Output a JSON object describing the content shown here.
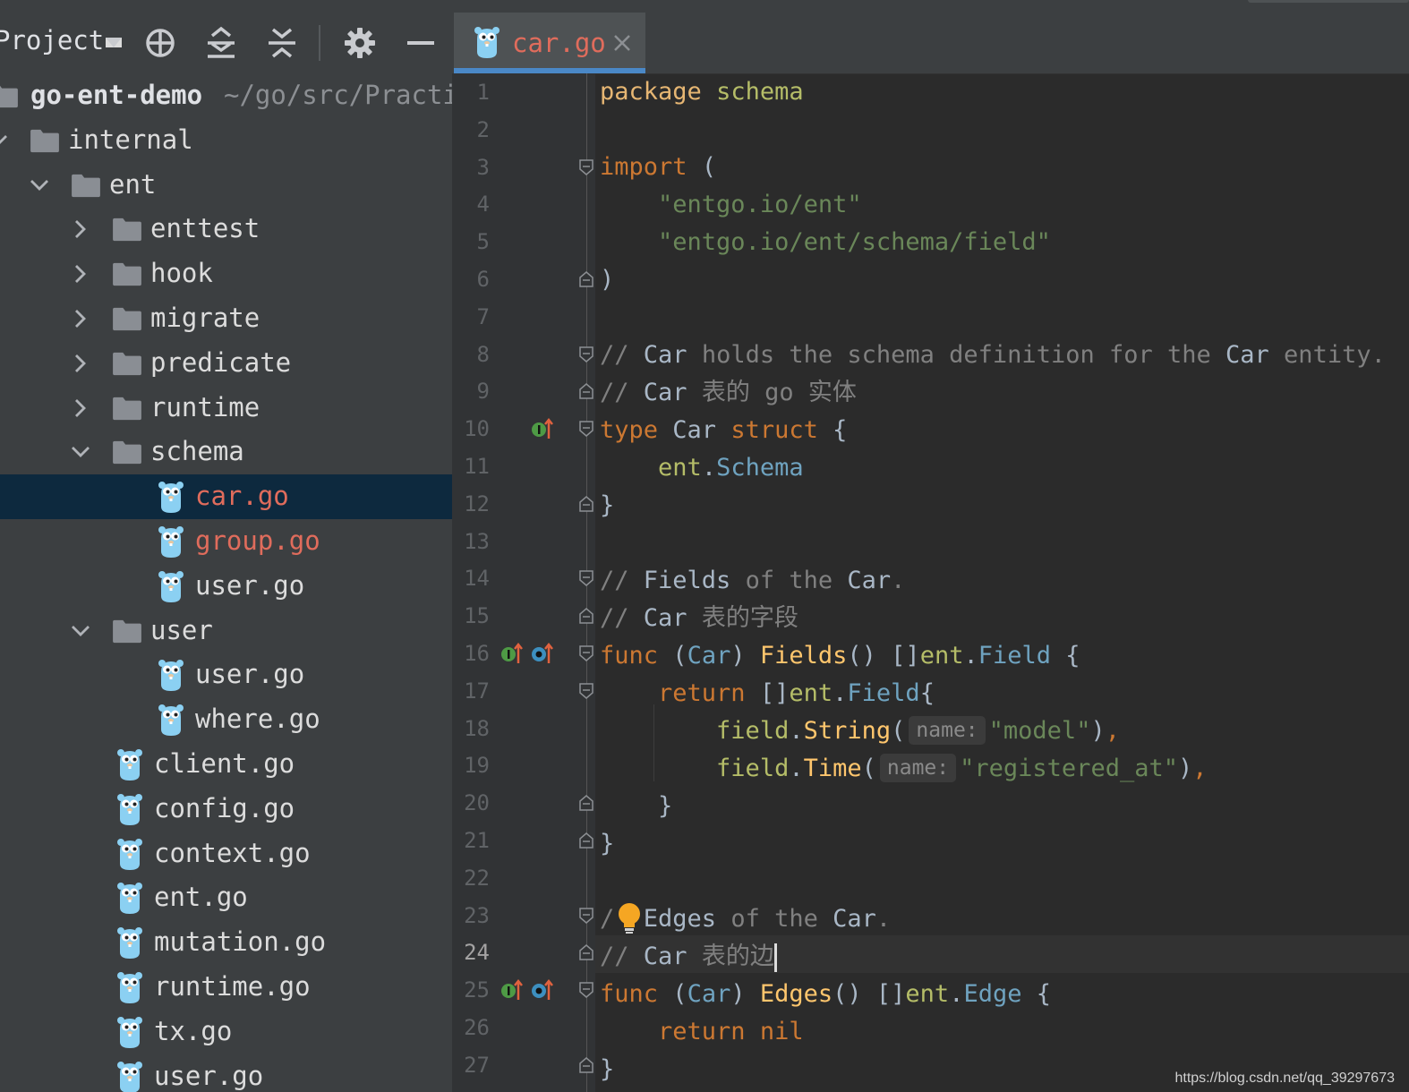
{
  "sidebar": {
    "project_label": "Project",
    "tree": [
      {
        "label": "go-ent-demo",
        "path": "~/go/src/Practi",
        "kind": "root"
      },
      {
        "label": "internal",
        "kind": "folder",
        "chevron": "down"
      },
      {
        "label": "ent",
        "kind": "folder",
        "chevron": "down"
      },
      {
        "label": "enttest",
        "kind": "folder",
        "chevron": "right"
      },
      {
        "label": "hook",
        "kind": "folder",
        "chevron": "right"
      },
      {
        "label": "migrate",
        "kind": "folder",
        "chevron": "right"
      },
      {
        "label": "predicate",
        "kind": "folder",
        "chevron": "right"
      },
      {
        "label": "runtime",
        "kind": "folder",
        "chevron": "right"
      },
      {
        "label": "schema",
        "kind": "folder",
        "chevron": "down"
      },
      {
        "label": "car.go",
        "kind": "file",
        "status": "modified",
        "selected": true
      },
      {
        "label": "group.go",
        "kind": "file",
        "status": "modified"
      },
      {
        "label": "user.go",
        "kind": "file"
      },
      {
        "label": "user",
        "kind": "folder",
        "chevron": "down"
      },
      {
        "label": "user.go",
        "kind": "file"
      },
      {
        "label": "where.go",
        "kind": "file"
      },
      {
        "label": "client.go",
        "kind": "file"
      },
      {
        "label": "config.go",
        "kind": "file"
      },
      {
        "label": "context.go",
        "kind": "file"
      },
      {
        "label": "ent.go",
        "kind": "file"
      },
      {
        "label": "mutation.go",
        "kind": "file"
      },
      {
        "label": "runtime.go",
        "kind": "file"
      },
      {
        "label": "tx.go",
        "kind": "file"
      },
      {
        "label": "user.go",
        "kind": "file"
      }
    ]
  },
  "editor": {
    "tab": {
      "label": "car.go",
      "icon": "gopher-icon",
      "close_icon": "close-icon"
    },
    "current_line": 24,
    "line_numbers": [
      "1",
      "2",
      "3",
      "4",
      "5",
      "6",
      "7",
      "8",
      "9",
      "10",
      "11",
      "12",
      "13",
      "14",
      "15",
      "16",
      "17",
      "18",
      "19",
      "20",
      "21",
      "22",
      "23",
      "24",
      "25",
      "26",
      "27"
    ],
    "code": {
      "l1_kw": "package",
      "l1_name": "schema",
      "l3_kw": "import",
      "l3_paren": "(",
      "l4_str": "\"entgo.io/ent\"",
      "l5_str": "\"entgo.io/ent/schema/field\"",
      "l6": ")",
      "l8_a": "// ",
      "l8_b": "Car",
      "l8_c": " holds the schema definition for the ",
      "l8_d": "Car",
      "l8_e": " entity.",
      "l9_a": "// ",
      "l9_b": "Car",
      "l9_c": " 表的 go 实体",
      "l10_kw": "type",
      "l10_name": "Car",
      "l10_kw2": "struct",
      "l10_brace": "{",
      "l11_pkg": "ent",
      "l11_dot": ".",
      "l11_ty": "Schema",
      "l12": "}",
      "l14_a": "// ",
      "l14_b": "Fields",
      "l14_c": " of the ",
      "l14_d": "Car",
      "l14_e": ".",
      "l15_a": "// ",
      "l15_b": "Car",
      "l15_c": " 表的字段",
      "l16_kw": "func",
      "l16_p1": "(",
      "l16_recv": "Car",
      "l16_p2": ") ",
      "l16_fn": "Fields",
      "l16_p3": "() []",
      "l16_pkg": "ent",
      "l16_dot": ".",
      "l16_ty": "Field",
      "l16_br": " {",
      "l17_kw": "return",
      "l17_a": " []",
      "l17_pkg": "ent",
      "l17_dot": ".",
      "l17_ty": "Field",
      "l17_br": "{",
      "l18_pkg": "field",
      "l18_dot": ".",
      "l18_fn": "String",
      "l18_p": "(",
      "l18_hint": "name:",
      "l18_str": "\"model\"",
      "l18_end": ")",
      "l18_comma": ",",
      "l19_pkg": "field",
      "l19_dot": ".",
      "l19_fn": "Time",
      "l19_p": "(",
      "l19_hint": "name:",
      "l19_str": "\"registered_at\"",
      "l19_end": ")",
      "l19_comma": ",",
      "l20": "}",
      "l21": "}",
      "l23_a": "/",
      "l23_b": "Edges",
      "l23_c": " of the ",
      "l23_d": "Car",
      "l23_e": ".",
      "l24_a": "// ",
      "l24_b": "Car",
      "l24_c": " 表的边",
      "l25_kw": "func",
      "l25_p1": "(",
      "l25_recv": "Car",
      "l25_p2": ") ",
      "l25_fn": "Edges",
      "l25_p3": "() []",
      "l25_pkg": "ent",
      "l25_dot": ".",
      "l25_ty": "Edge",
      "l25_br": " {",
      "l26_kw": "return",
      "l26_nil": "nil",
      "l27": "}"
    }
  },
  "watermark": "https://blog.csdn.net/qq_39297673",
  "colors": {
    "selection": "#0d293e",
    "modified_file": "#e06c5c",
    "tab_underline": "#4a88c7",
    "keyword": "#cc7832",
    "string": "#6a8759",
    "function": "#ffc66d"
  }
}
